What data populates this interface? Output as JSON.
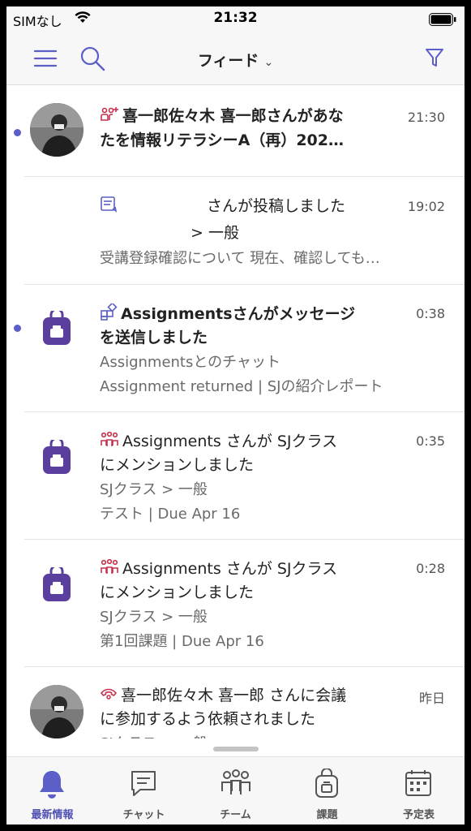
{
  "status_bar": {
    "carrier": "SIMなし",
    "time": "21:32"
  },
  "header": {
    "title": "フィード",
    "title_chevron": "⌄"
  },
  "feed": [
    {
      "line1": "喜一郎佐々木 喜一郎さんがあな",
      "line2": "たを情報リテラシーA（再）202…",
      "time": "21:30",
      "unread": true,
      "icon": "team-mention-icon"
    },
    {
      "line1": "さんが投稿しました",
      "line2": "> 一般",
      "line3": "受講登録確認について 現在、確認しても…",
      "time": "19:02",
      "unread": false,
      "icon": "post-reply-icon"
    },
    {
      "line1": "Assignmentsさんがメッセージ",
      "line2": "を送信しました",
      "line3": "Assignmentsとのチャット",
      "line4": "Assignment returned | SJの紹介レポート",
      "time": "0:38",
      "unread": true,
      "icon": "app-icon"
    },
    {
      "line1": "Assignments さんが SJクラス",
      "line2": "にメンションしました",
      "line3": "SJクラス > 一般",
      "line4": "テスト | Due Apr 16",
      "time": "0:35",
      "unread": false,
      "icon": "team-mention-icon"
    },
    {
      "line1": "Assignments さんが SJクラス",
      "line2": "にメンションしました",
      "line3": "SJクラス > 一般",
      "line4": "第1回課題 | Due Apr 16",
      "time": "0:28",
      "unread": false,
      "icon": "team-mention-icon"
    },
    {
      "line1": "喜一郎佐々木 喜一郎 さんに会議",
      "line2": "に参加するよう依頼されました",
      "line3": "SJクラス > 一般",
      "time": "昨日",
      "unread": false,
      "icon": "call-icon"
    }
  ],
  "tabs": [
    {
      "label": "最新情報",
      "icon": "bell-icon",
      "active": true
    },
    {
      "label": "チャット",
      "icon": "chat-icon",
      "active": false
    },
    {
      "label": "チーム",
      "icon": "teams-icon",
      "active": false
    },
    {
      "label": "課題",
      "icon": "assignments-icon",
      "active": false
    },
    {
      "label": "予定表",
      "icon": "calendar-icon",
      "active": false
    }
  ],
  "colors": {
    "accent": "#5b5fc7",
    "alert": "#c4314b",
    "bag": "#5b3f9e"
  }
}
